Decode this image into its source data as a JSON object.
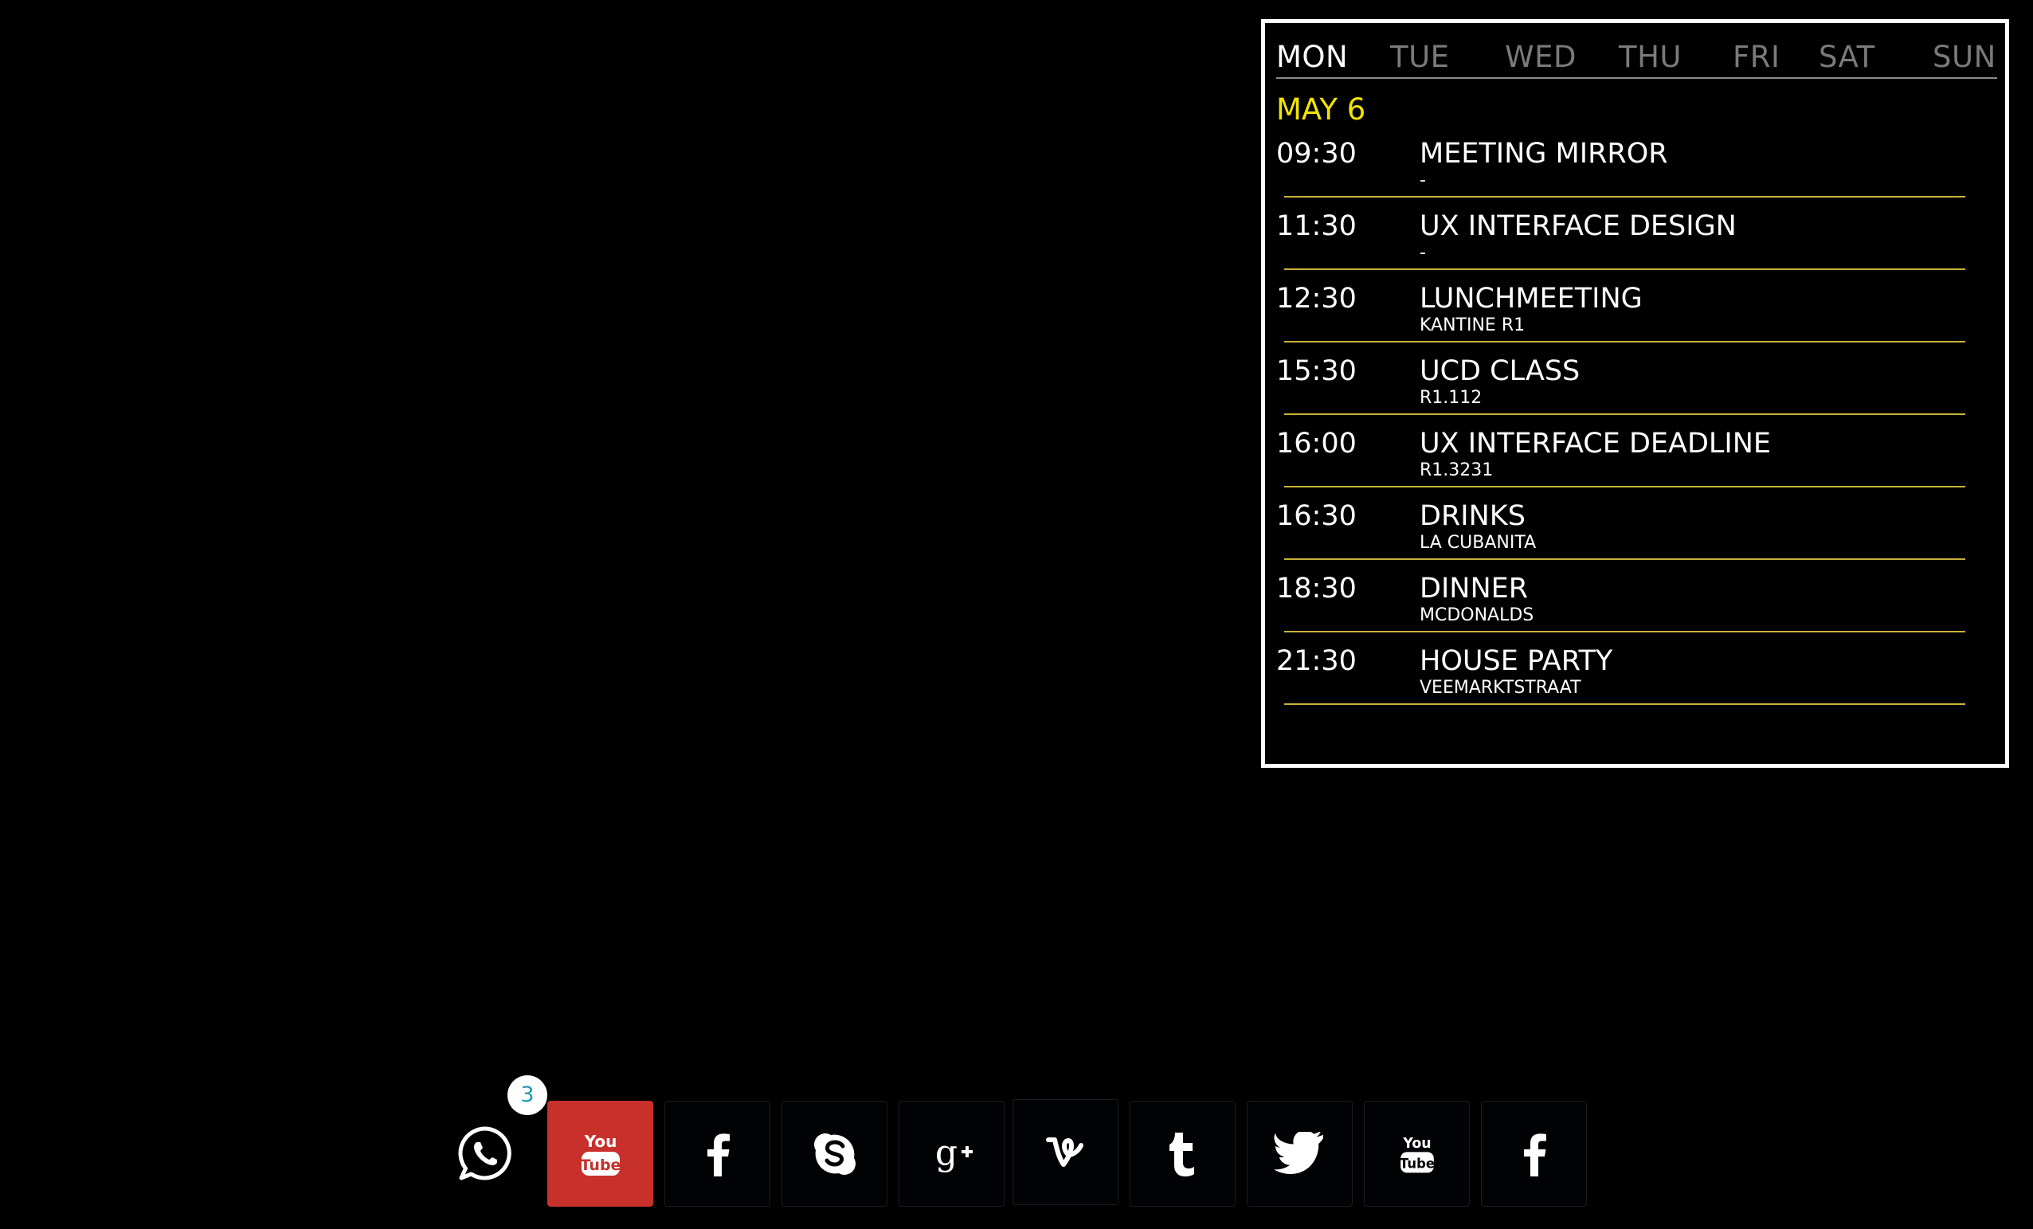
{
  "calendar": {
    "days": [
      "MON",
      "TUE",
      "WED",
      "THU",
      "FRI",
      "SAT",
      "SUN"
    ],
    "active_day": "MON",
    "date_label": "MAY 6",
    "events": [
      {
        "time": "09:30",
        "title": "MEETING MIRROR",
        "location": "-"
      },
      {
        "time": "11:30",
        "title": "UX INTERFACE DESIGN",
        "location": "-"
      },
      {
        "time": "12:30",
        "title": "LUNCHMEETING",
        "location": "KANTINE R1"
      },
      {
        "time": "15:30",
        "title": "UCD CLASS",
        "location": "R1.112"
      },
      {
        "time": "16:00",
        "title": "UX INTERFACE DEADLINE",
        "location": "R1.3231"
      },
      {
        "time": "16:30",
        "title": "DRINKS",
        "location": "LA CUBANITA"
      },
      {
        "time": "18:30",
        "title": "DINNER",
        "location": "MCDONALDS"
      },
      {
        "time": "21:30",
        "title": "HOUSE PARTY",
        "location": "VEEMARKTSTRAAT"
      }
    ]
  },
  "social_bar": {
    "notification_count": "3",
    "apps": [
      {
        "name": "whatsapp",
        "icon": "whatsapp-icon",
        "active": false
      },
      {
        "name": "youtube",
        "icon": "youtube-icon",
        "active": true
      },
      {
        "name": "facebook",
        "icon": "facebook-icon",
        "active": false
      },
      {
        "name": "skype",
        "icon": "skype-icon",
        "active": false
      },
      {
        "name": "google-plus",
        "icon": "google-plus-icon",
        "active": false
      },
      {
        "name": "vine",
        "icon": "vine-icon",
        "active": false
      },
      {
        "name": "tumblr",
        "icon": "tumblr-icon",
        "active": false
      },
      {
        "name": "twitter",
        "icon": "twitter-icon",
        "active": false
      },
      {
        "name": "youtube",
        "icon": "youtube-icon",
        "active": false
      },
      {
        "name": "facebook",
        "icon": "facebook-icon",
        "active": false
      }
    ]
  },
  "colors": {
    "background": "#000000",
    "date_accent": "#f2e400",
    "divider": "#c9b23a",
    "active_tile": "#c8302c",
    "badge_text": "#1f9bb0"
  }
}
